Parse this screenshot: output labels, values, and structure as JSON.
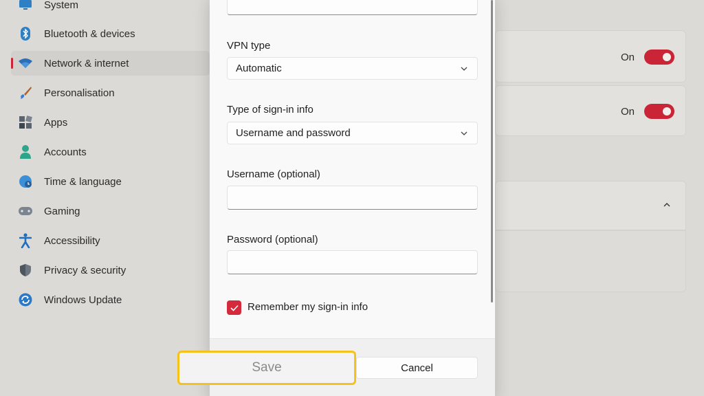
{
  "sidebar": {
    "items": [
      {
        "label": "System",
        "icon": "monitor-icon"
      },
      {
        "label": "Bluetooth & devices",
        "icon": "bluetooth-icon"
      },
      {
        "label": "Network & internet",
        "icon": "wifi-icon",
        "active": true
      },
      {
        "label": "Personalisation",
        "icon": "brush-icon"
      },
      {
        "label": "Apps",
        "icon": "apps-icon"
      },
      {
        "label": "Accounts",
        "icon": "person-icon"
      },
      {
        "label": "Time & language",
        "icon": "globe-clock-icon"
      },
      {
        "label": "Gaming",
        "icon": "gamepad-icon"
      },
      {
        "label": "Accessibility",
        "icon": "accessibility-icon"
      },
      {
        "label": "Privacy & security",
        "icon": "shield-icon"
      },
      {
        "label": "Windows Update",
        "icon": "update-icon"
      }
    ]
  },
  "background_settings": {
    "toggle1_label": "On",
    "toggle2_label": "On"
  },
  "dialog": {
    "vpn_type_label": "VPN type",
    "vpn_type_value": "Automatic",
    "signin_type_label": "Type of sign-in info",
    "signin_type_value": "Username and password",
    "username_label": "Username (optional)",
    "username_value": "",
    "password_label": "Password (optional)",
    "password_value": "",
    "remember_label": "Remember my sign-in info",
    "remember_checked": true,
    "save_label": "Save",
    "cancel_label": "Cancel"
  },
  "colors": {
    "accent": "#d42a3c",
    "highlight": "#f5c21b"
  }
}
